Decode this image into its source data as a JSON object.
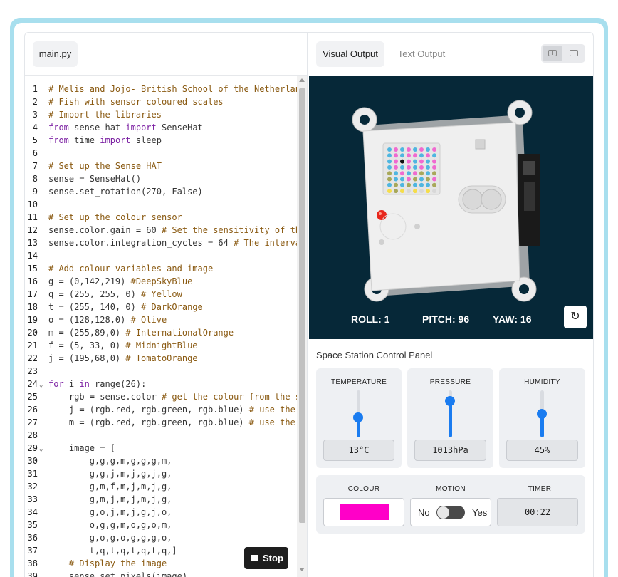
{
  "editor": {
    "file_tab": "main.py",
    "stop_label": "Stop",
    "lines": [
      {
        "n": "1",
        "segs": [
          {
            "t": "# Melis and Jojo- British School of the Netherlands",
            "c": "c"
          }
        ]
      },
      {
        "n": "2",
        "segs": [
          {
            "t": "# Fish with sensor coloured scales",
            "c": "c"
          }
        ]
      },
      {
        "n": "3",
        "segs": [
          {
            "t": "# Import the libraries",
            "c": "c"
          }
        ]
      },
      {
        "n": "4",
        "segs": [
          {
            "t": "from",
            "c": "k"
          },
          {
            "t": " sense_hat "
          },
          {
            "t": "import",
            "c": "k"
          },
          {
            "t": " SenseHat"
          }
        ]
      },
      {
        "n": "5",
        "segs": [
          {
            "t": "from",
            "c": "k"
          },
          {
            "t": " time "
          },
          {
            "t": "import",
            "c": "k"
          },
          {
            "t": " sleep"
          }
        ]
      },
      {
        "n": "6",
        "segs": []
      },
      {
        "n": "7",
        "segs": [
          {
            "t": "# Set up the Sense HAT",
            "c": "c"
          }
        ]
      },
      {
        "n": "8",
        "segs": [
          {
            "t": "sense = SenseHat()"
          }
        ]
      },
      {
        "n": "9",
        "segs": [
          {
            "t": "sense.set_rotation(270, False)"
          }
        ]
      },
      {
        "n": "10",
        "segs": []
      },
      {
        "n": "11",
        "segs": [
          {
            "t": "# Set up the colour sensor",
            "c": "c"
          }
        ]
      },
      {
        "n": "12",
        "segs": [
          {
            "t": "sense.color.gain = 60 "
          },
          {
            "t": "# Set the sensitivity of the sensor",
            "c": "c"
          }
        ]
      },
      {
        "n": "13",
        "segs": [
          {
            "t": "sense.color.integration_cycles = 64 "
          },
          {
            "t": "# The interval",
            "c": "c"
          }
        ]
      },
      {
        "n": "14",
        "segs": []
      },
      {
        "n": "15",
        "segs": [
          {
            "t": "# Add colour variables and image",
            "c": "c"
          }
        ]
      },
      {
        "n": "16",
        "segs": [
          {
            "t": "g = (0,142,219) "
          },
          {
            "t": "#DeepSkyBlue",
            "c": "c"
          }
        ]
      },
      {
        "n": "17",
        "segs": [
          {
            "t": "q = (255, 255, 0) "
          },
          {
            "t": "# Yellow",
            "c": "c"
          }
        ]
      },
      {
        "n": "18",
        "segs": [
          {
            "t": "t = (255, 140, 0) "
          },
          {
            "t": "# DarkOrange",
            "c": "c"
          }
        ]
      },
      {
        "n": "19",
        "segs": [
          {
            "t": "o = (128,128,0) "
          },
          {
            "t": "# Olive",
            "c": "c"
          }
        ]
      },
      {
        "n": "20",
        "segs": [
          {
            "t": "m = (255,89,0) "
          },
          {
            "t": "# InternationalOrange",
            "c": "c"
          }
        ]
      },
      {
        "n": "21",
        "segs": [
          {
            "t": "f = (5, 33, 0) "
          },
          {
            "t": "# MidnightBlue",
            "c": "c"
          }
        ]
      },
      {
        "n": "22",
        "segs": [
          {
            "t": "j = (195,68,0) "
          },
          {
            "t": "# TomatoOrange",
            "c": "c"
          }
        ]
      },
      {
        "n": "23",
        "segs": []
      },
      {
        "n": "24",
        "fold": true,
        "segs": [
          {
            "t": "for",
            "c": "k"
          },
          {
            "t": " i "
          },
          {
            "t": "in",
            "c": "k"
          },
          {
            "t": " range(26):"
          }
        ]
      },
      {
        "n": "25",
        "segs": [
          {
            "t": "    rgb = sense.color "
          },
          {
            "t": "# get the colour from the sensor",
            "c": "c"
          }
        ]
      },
      {
        "n": "26",
        "segs": [
          {
            "t": "    j = (rgb.red, rgb.green, rgb.blue) "
          },
          {
            "t": "# use the",
            "c": "c"
          }
        ]
      },
      {
        "n": "27",
        "segs": [
          {
            "t": "    m = (rgb.red, rgb.green, rgb.blue) "
          },
          {
            "t": "# use the",
            "c": "c"
          }
        ]
      },
      {
        "n": "28",
        "segs": []
      },
      {
        "n": "29",
        "fold": true,
        "segs": [
          {
            "t": "    image = ["
          }
        ]
      },
      {
        "n": "30",
        "segs": [
          {
            "t": "        g,g,g,m,g,g,g,m,"
          }
        ]
      },
      {
        "n": "31",
        "segs": [
          {
            "t": "        g,g,j,m,j,g,j,g,"
          }
        ]
      },
      {
        "n": "32",
        "segs": [
          {
            "t": "        g,m,f,m,j,m,j,g,"
          }
        ]
      },
      {
        "n": "33",
        "segs": [
          {
            "t": "        g,m,j,m,j,m,j,g,"
          }
        ]
      },
      {
        "n": "34",
        "segs": [
          {
            "t": "        g,o,j,m,j,g,j,o,"
          }
        ]
      },
      {
        "n": "35",
        "segs": [
          {
            "t": "        o,g,g,m,o,g,o,m,"
          }
        ]
      },
      {
        "n": "36",
        "segs": [
          {
            "t": "        g,o,g,o,g,g,g,o,"
          }
        ]
      },
      {
        "n": "37",
        "segs": [
          {
            "t": "        t,q,t,q,t,q,t,q,]"
          }
        ]
      },
      {
        "n": "38",
        "segs": [
          {
            "t": "    "
          },
          {
            "t": "# Display the image",
            "c": "c"
          }
        ]
      },
      {
        "n": "39",
        "segs": [
          {
            "t": "    sense.set_pixels(image)"
          }
        ]
      }
    ]
  },
  "output": {
    "tabs": {
      "visual": "Visual Output",
      "text": "Text Output"
    },
    "readouts": {
      "roll": "ROLL: 1",
      "pitch": "PITCH: 96",
      "yaw": "YAW: 16"
    }
  },
  "panel": {
    "title": "Space Station Control Panel",
    "temperature": {
      "label": "TEMPERATURE",
      "value": "13°C",
      "level": 0.42
    },
    "pressure": {
      "label": "PRESSURE",
      "value": "1013hPa",
      "level": 0.78
    },
    "humidity": {
      "label": "HUMIDITY",
      "value": "45%",
      "level": 0.5
    },
    "colour": {
      "label": "COLOUR",
      "swatch": "#ff00c8"
    },
    "motion": {
      "label": "MOTION",
      "no": "No",
      "yes": "Yes"
    },
    "timer": {
      "label": "TIMER",
      "value": "00:22"
    }
  },
  "led_palette": {
    "blue": "#4fb6e0",
    "pink": "#f06ad0",
    "olive": "#a8a85a",
    "yellow": "#f5dd4a",
    "black": "#111111",
    "off": "#d8d8d8"
  }
}
